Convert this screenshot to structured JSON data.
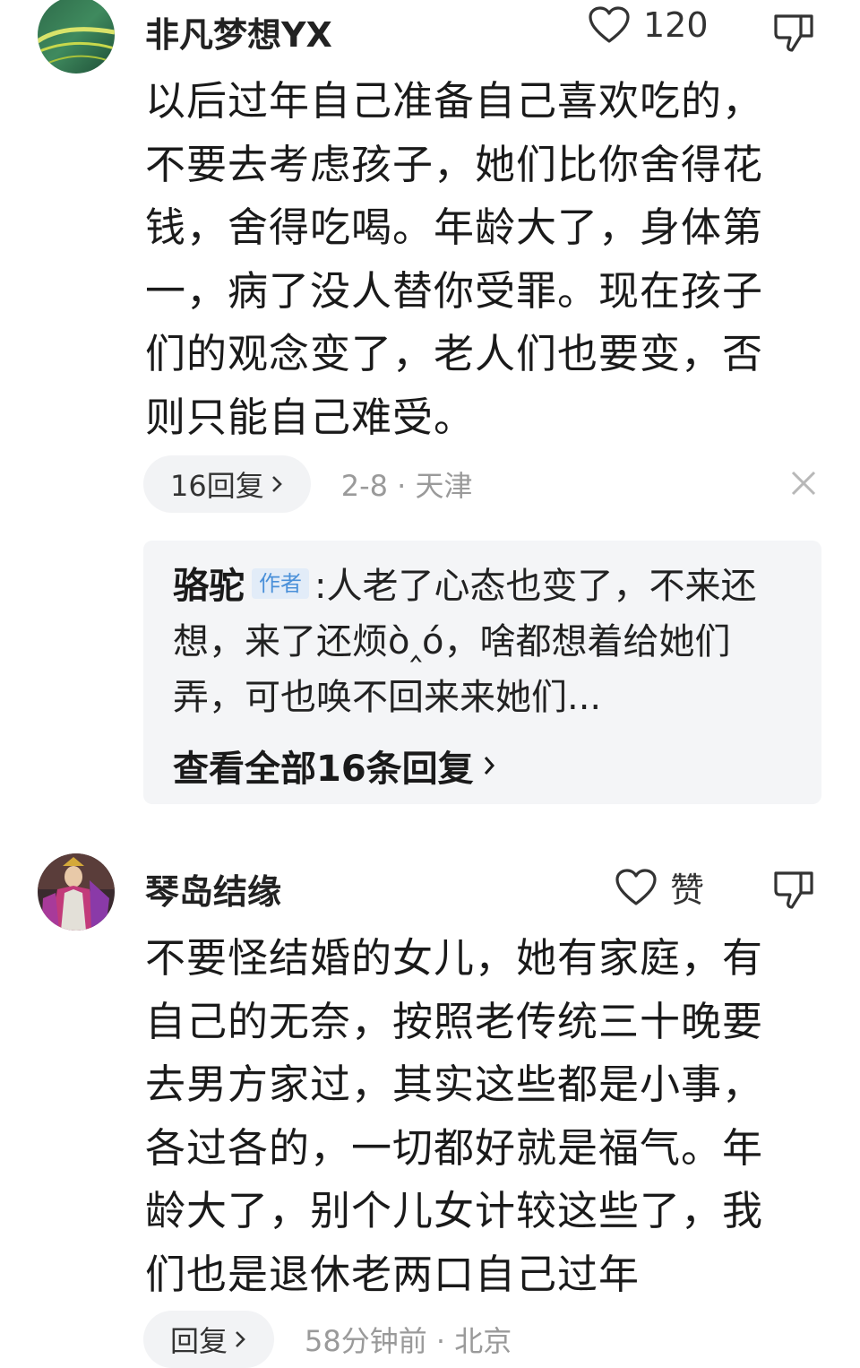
{
  "comments": [
    {
      "username": "非凡梦想YX",
      "like_count": "120",
      "text": "以后过年自己准备自己喜欢吃的，不要去考虑孩子，她们比你舍得花钱，舍得吃喝。年龄大了，身体第一，病了没人替你受罪。现在孩子们的观念变了，老人们也要变，否则只能自己难受。",
      "reply_label": "16回复",
      "meta": "2-8 · 天津",
      "top_reply": {
        "author": "骆驼",
        "badge": "作者",
        "separator": ":",
        "text": "人老了心态也变了，不来还想，来了还烦ò‸ó，啥都想着给她们弄，可也唤不回来来她们...",
        "view_all": "查看全部16条回复"
      },
      "icons": {
        "avatar": "avatar-image",
        "like": "heart-outline-icon",
        "dislike": "thumbs-down-icon",
        "chevron": "chevron-right-icon",
        "close": "close-icon"
      }
    },
    {
      "username": "琴岛结缘",
      "like_count": "赞",
      "text": "不要怪结婚的女儿，她有家庭，有自己的无奈，按照老传统三十晚要去男方家过，其实这些都是小事，各过各的，一切都好就是福气。年龄大了，别个儿女计较这些了，我们也是退休老两口自己过年",
      "reply_label": "回复",
      "meta": "58分钟前 · 北京"
    }
  ],
  "colors": {
    "pill_bg": "#f2f3f5",
    "reply_box_bg": "#f4f5f7",
    "meta_text": "#9a9a9a",
    "badge_text": "#4a90d9",
    "badge_bg": "#e2ecf8"
  }
}
